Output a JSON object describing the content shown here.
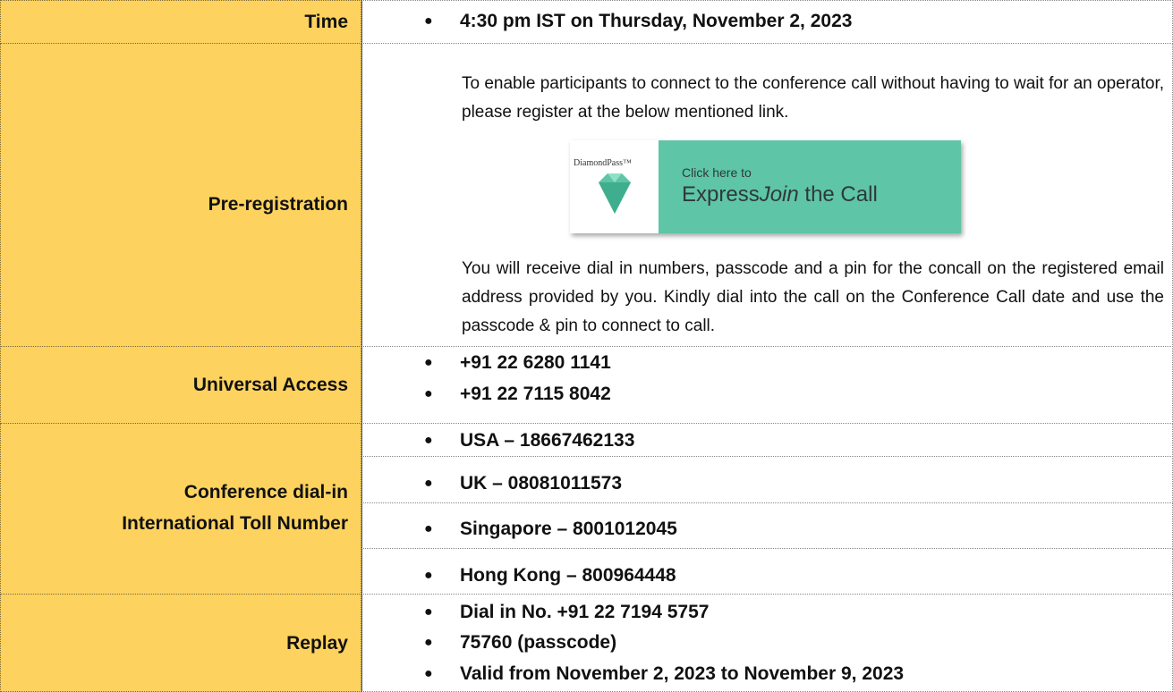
{
  "rows": {
    "time": {
      "label": "Time",
      "items": [
        "4:30 pm IST on Thursday, November 2, 2023"
      ]
    },
    "prereg": {
      "label": "Pre-registration",
      "intro": "To enable participants to connect to the conference call without having to wait for an operator, please register at the below mentioned link.",
      "banner": {
        "logo_text": "DiamondPass™",
        "small_text": "Click here to",
        "big_text_1": "Express",
        "big_text_2": "Join",
        "big_text_3": " the Call"
      },
      "info": "You will receive dial in numbers, passcode and a pin for the concall on the registered email address provided by you. Kindly dial into the call on the Conference Call date and use the passcode & pin to connect to call."
    },
    "universal": {
      "label": "Universal Access",
      "items": [
        "+91 22 6280 1141",
        "+91 22 7115 8042"
      ]
    },
    "conference": {
      "label_line1": "Conference dial-in",
      "label_line2": "International Toll Number",
      "items": [
        "USA – 18667462133",
        "UK – 08081011573",
        "Singapore – 8001012045",
        "Hong Kong – 800964448"
      ]
    },
    "replay": {
      "label": "Replay",
      "items": [
        "Dial in No. +91 22 7194 5757",
        "75760 (passcode)",
        "Valid from November 2, 2023 to November 9, 2023"
      ]
    }
  },
  "bullet": "●",
  "colors": {
    "label_bg": "#fdd25f",
    "banner_teal": "#5ec5a6",
    "gem": "#5ec5a6"
  }
}
